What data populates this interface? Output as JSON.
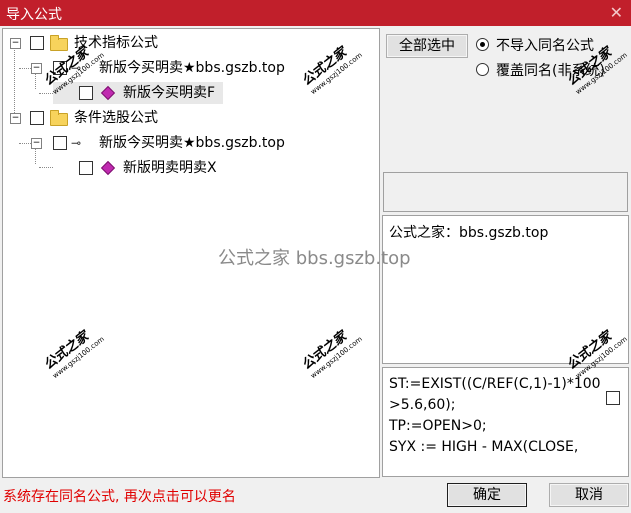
{
  "window": {
    "title": "导入公式",
    "close_glyph": "✕"
  },
  "tree": {
    "nodes": [
      {
        "label": "技术指标公式",
        "expand": "−"
      },
      {
        "label": "新版今买明卖★bbs.gszb.top",
        "expand": "−"
      },
      {
        "label": "新版今买明卖F"
      },
      {
        "label": "条件选股公式",
        "expand": "−"
      },
      {
        "label": "新版今买明卖★bbs.gszb.top",
        "expand": "−"
      },
      {
        "label": "新版明卖明卖X"
      }
    ]
  },
  "actions": {
    "select_all": "全部选中",
    "opt_skip": "不导入同名公式",
    "opt_overwrite": "覆盖同名(非系统)"
  },
  "info": {
    "text": "公式之家：bbs.gszb.top"
  },
  "code": {
    "text": "ST:=EXIST((C/REF(C,1)-1)*100>5.6,60);\nTP:=OPEN>0;\nSYX := HIGH - MAX(CLOSE,"
  },
  "watermark": {
    "center": "公式之家 bbs.gszb.top",
    "cn": "公式之家",
    "en": "www.gszj100.com"
  },
  "status": {
    "text": "系统存在同名公式, 再次点击可以更名"
  },
  "footer": {
    "ok": "确定",
    "cancel": "取消"
  }
}
